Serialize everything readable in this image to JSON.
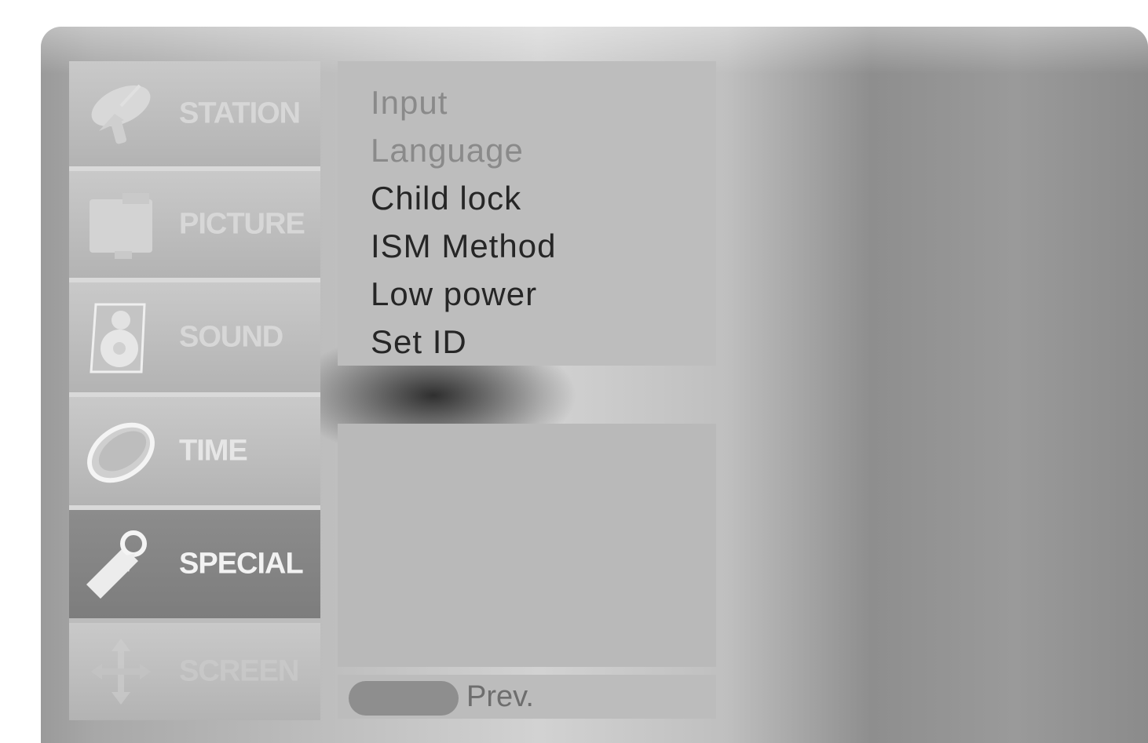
{
  "menu": {
    "items": [
      {
        "label": "STATION",
        "icon": "satellite-dish-icon",
        "state": "inactive"
      },
      {
        "label": "PICTURE",
        "icon": "picture-frame-icon",
        "state": "inactive"
      },
      {
        "label": "SOUND",
        "icon": "speaker-icon",
        "state": "inactive"
      },
      {
        "label": "TIME",
        "icon": "clock-icon",
        "state": "inactive"
      },
      {
        "label": "SPECIAL",
        "icon": "tag-icon",
        "state": "active"
      },
      {
        "label": "SCREEN",
        "icon": "move-arrows-icon",
        "state": "inactive"
      }
    ]
  },
  "submenu": {
    "items": [
      {
        "label": "Input",
        "enabled": false
      },
      {
        "label": "Language",
        "enabled": false
      },
      {
        "label": "Child lock",
        "enabled": true
      },
      {
        "label": "ISM Method",
        "enabled": true
      },
      {
        "label": "Low power",
        "enabled": true
      },
      {
        "label": "Set ID",
        "enabled": true
      }
    ]
  },
  "hint": {
    "button_icon": "menu-button-icon",
    "label": "Prev."
  },
  "colors": {
    "panel": "#bdbdbd",
    "active_item": "#808080",
    "text_dark": "#262626",
    "text_disabled": "#8a8a8a"
  }
}
